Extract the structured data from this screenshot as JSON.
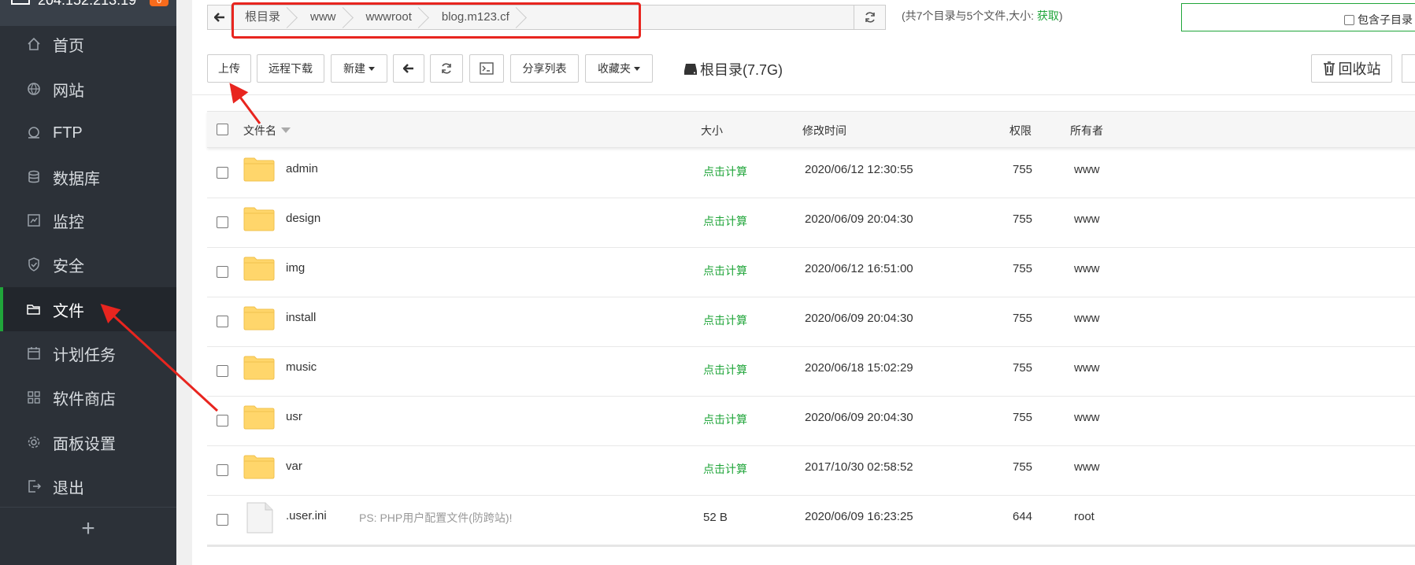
{
  "sidebar": {
    "server_ip": "204.152.213.19",
    "badge": "0",
    "items": [
      {
        "label": "首页",
        "icon": "home-icon"
      },
      {
        "label": "网站",
        "icon": "globe-icon"
      },
      {
        "label": "FTP",
        "icon": "ftp-icon"
      },
      {
        "label": "数据库",
        "icon": "database-icon"
      },
      {
        "label": "监控",
        "icon": "monitor-chart-icon"
      },
      {
        "label": "安全",
        "icon": "shield-icon"
      },
      {
        "label": "文件",
        "icon": "folder-icon",
        "active": true
      },
      {
        "label": "计划任务",
        "icon": "calendar-icon"
      },
      {
        "label": "软件商店",
        "icon": "apps-icon"
      },
      {
        "label": "面板设置",
        "icon": "gear-icon"
      },
      {
        "label": "退出",
        "icon": "logout-icon"
      }
    ],
    "add_label": "+"
  },
  "pathbar": {
    "crumbs": [
      "根目录",
      "www",
      "wwwroot",
      "blog.m123.cf"
    ],
    "summary_prefix": "(共7个目录与5个文件,大小: ",
    "summary_link": "获取",
    "summary_suffix": ")",
    "search_checkbox_label": "包含子目录"
  },
  "toolbar": {
    "upload": "上传",
    "remote_download": "远程下载",
    "new": "新建",
    "share_list": "分享列表",
    "favorites": "收藏夹",
    "disk": "根目录(7.7G)",
    "recycle_bin": "回收站"
  },
  "table": {
    "headers": {
      "name": "文件名",
      "size": "大小",
      "mtime": "修改时间",
      "perm": "权限",
      "owner": "所有者"
    },
    "rows": [
      {
        "type": "folder",
        "name": "admin",
        "size": "点击计算",
        "mtime": "2020/06/12 12:30:55",
        "perm": "755",
        "owner": "www"
      },
      {
        "type": "folder",
        "name": "design",
        "size": "点击计算",
        "mtime": "2020/06/09 20:04:30",
        "perm": "755",
        "owner": "www"
      },
      {
        "type": "folder",
        "name": "img",
        "size": "点击计算",
        "mtime": "2020/06/12 16:51:00",
        "perm": "755",
        "owner": "www"
      },
      {
        "type": "folder",
        "name": "install",
        "size": "点击计算",
        "mtime": "2020/06/09 20:04:30",
        "perm": "755",
        "owner": "www"
      },
      {
        "type": "folder",
        "name": "music",
        "size": "点击计算",
        "mtime": "2020/06/18 15:02:29",
        "perm": "755",
        "owner": "www"
      },
      {
        "type": "folder",
        "name": "usr",
        "size": "点击计算",
        "mtime": "2020/06/09 20:04:30",
        "perm": "755",
        "owner": "www"
      },
      {
        "type": "folder",
        "name": "var",
        "size": "点击计算",
        "mtime": "2017/10/30 02:58:52",
        "perm": "755",
        "owner": "www"
      },
      {
        "type": "file",
        "name": ".user.ini",
        "note": "PS: PHP用户配置文件(防跨站)!",
        "size": "52 B",
        "mtime": "2020/06/09 16:23:25",
        "perm": "644",
        "owner": "root"
      }
    ]
  },
  "colors": {
    "accent": "#20a53a",
    "annotation": "#e8251f",
    "sidebar_bg": "#2c3138"
  }
}
